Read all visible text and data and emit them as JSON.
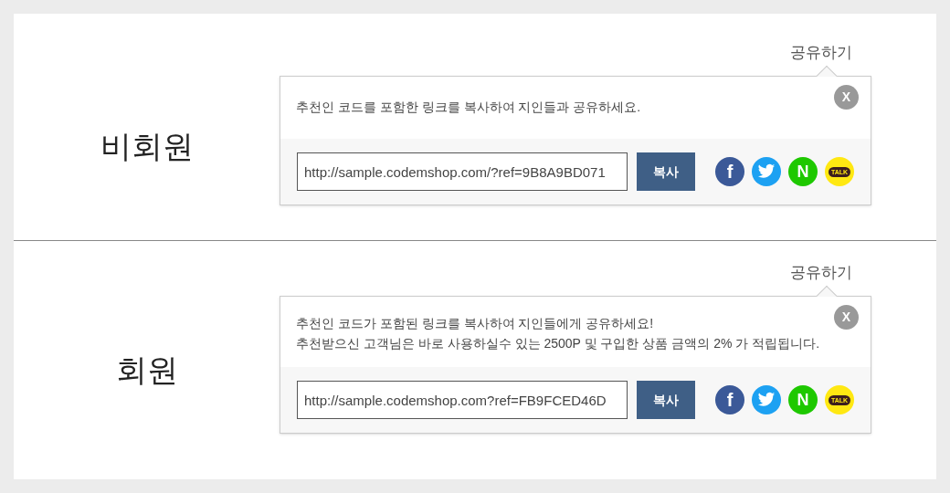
{
  "sections": [
    {
      "title": "비회원",
      "share_label": "공유하기",
      "close": "X",
      "message_lines": [
        "추천인 코드를 포함한 링크를 복사하여 지인들과 공유하세요."
      ],
      "link": "http://sample.codemshop.com/?ref=9B8A9BD071",
      "copy_button": "복사",
      "share_buttons": [
        {
          "kind": "facebook",
          "label": "f"
        },
        {
          "kind": "twitter"
        },
        {
          "kind": "naver",
          "label": "N"
        },
        {
          "kind": "kakaotalk",
          "label": "TALK"
        }
      ]
    },
    {
      "title": "회원",
      "share_label": "공유하기",
      "close": "X",
      "message_lines": [
        "추천인 코드가 포함된 링크를 복사하여 지인들에게 공유하세요!",
        "추천받으신 고객님은 바로 사용하실수 있는 2500P 및 구입한 상품 금액의 2% 가 적립됩니다."
      ],
      "link": "http://sample.codemshop.com?ref=FB9FCED46D",
      "copy_button": "복사",
      "share_buttons": [
        {
          "kind": "facebook",
          "label": "f"
        },
        {
          "kind": "twitter"
        },
        {
          "kind": "naver",
          "label": "N"
        },
        {
          "kind": "kakaotalk",
          "label": "TALK"
        }
      ]
    }
  ]
}
